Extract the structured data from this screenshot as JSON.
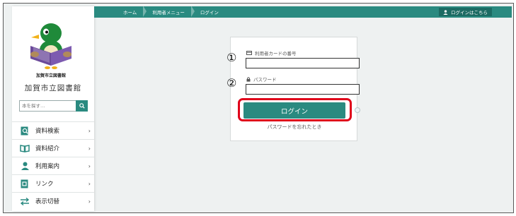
{
  "breadcrumb": {
    "items": [
      "ホーム",
      "利用者メニュー",
      "ログイン"
    ]
  },
  "header": {
    "login_link_label": "ログインはこちら"
  },
  "sidebar": {
    "library_name": "加賀市立図書館",
    "logo_caption": "加賀市立図書館",
    "search": {
      "placeholder": "本を探す…"
    },
    "menu": [
      {
        "label": "資料検索",
        "icon": "search-doc-icon"
      },
      {
        "label": "資料紹介",
        "icon": "open-book-icon"
      },
      {
        "label": "利用案内",
        "icon": "person-icon"
      },
      {
        "label": "リンク",
        "icon": "link-doc-icon"
      },
      {
        "label": "表示切替",
        "icon": "swap-arrows-icon"
      }
    ]
  },
  "login": {
    "card_label": "利用者カードの番号",
    "password_label": "パスワード",
    "marker_1": "①",
    "marker_2": "②",
    "button_label": "ログイン",
    "forgot_label": "パスワードを忘れたとき"
  },
  "colors": {
    "accent": "#2a8a80",
    "highlight": "#e0001a",
    "background": "#eef1f1"
  }
}
